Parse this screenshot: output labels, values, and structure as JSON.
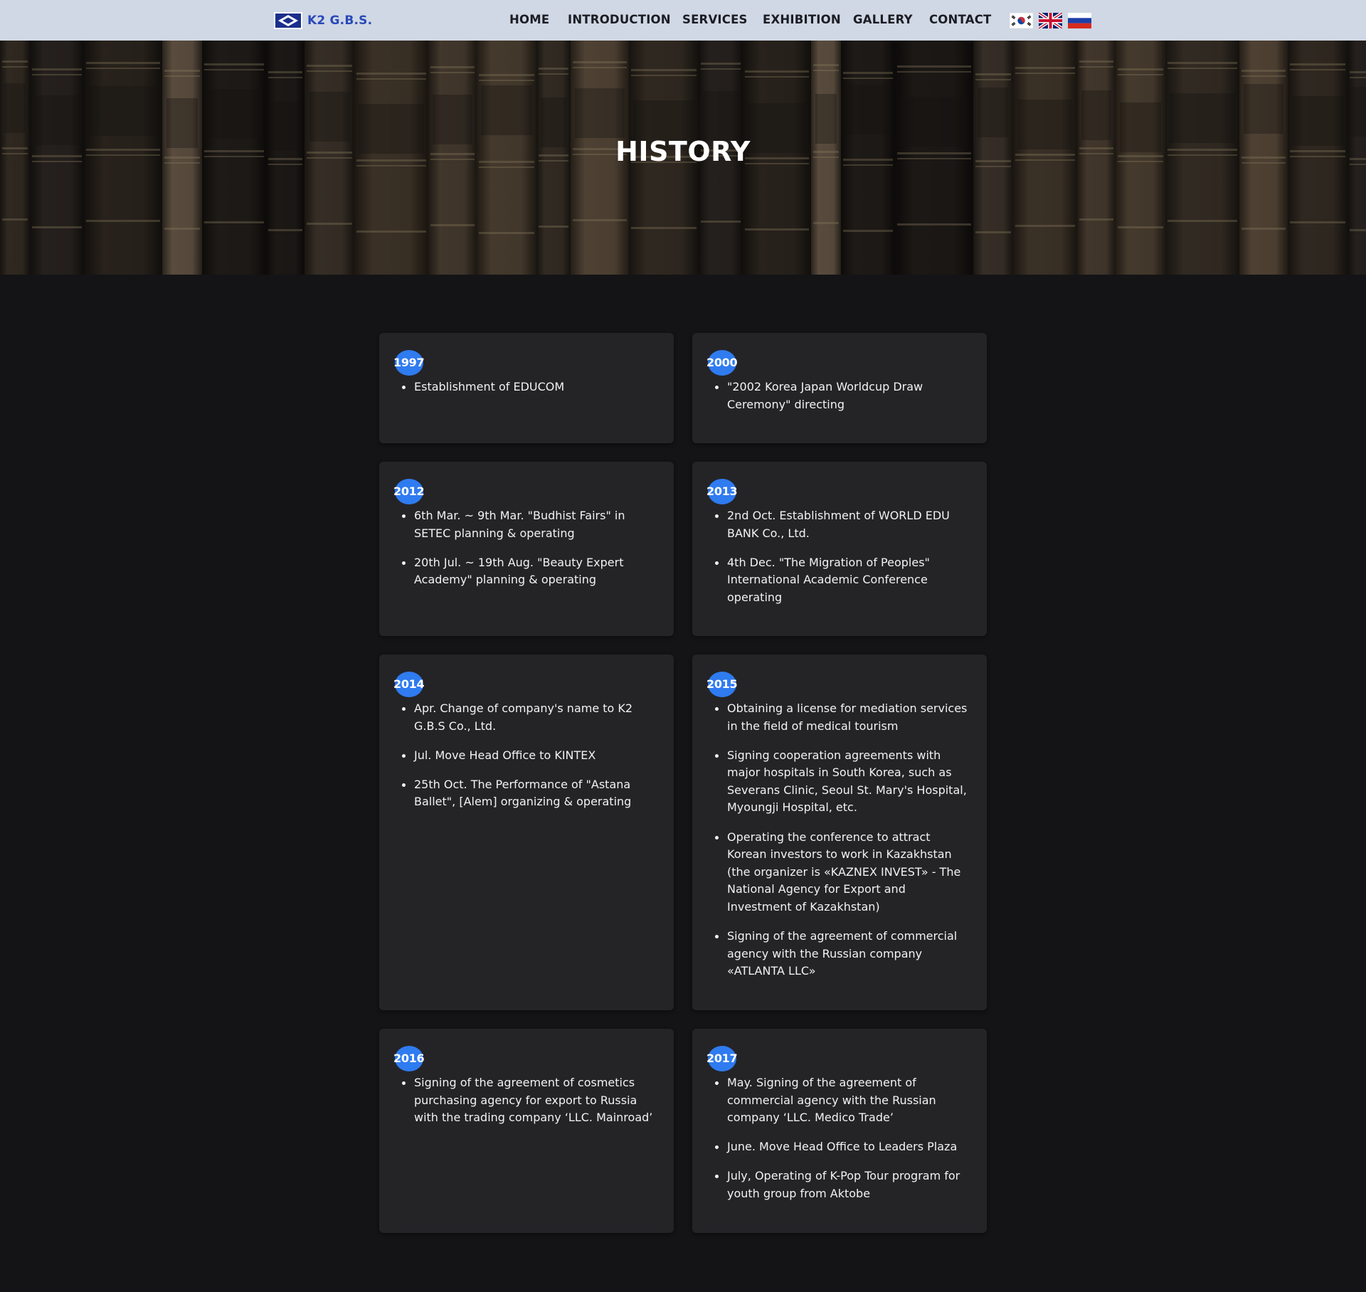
{
  "nav": {
    "brand": "K2 G.B.S.",
    "links": [
      "HOME",
      "INTRODUCTION",
      "SERVICES",
      "EXHIBITION",
      "GALLERY",
      "CONTACT"
    ]
  },
  "hero": {
    "title": "HISTORY"
  },
  "history": [
    {
      "year": "1997",
      "items": [
        "Establishment of EDUCOM"
      ]
    },
    {
      "year": "2000",
      "items": [
        "\"2002 Korea Japan Worldcup Draw Ceremony\" directing"
      ]
    },
    {
      "year": "2012",
      "items": [
        "6th Mar. ~ 9th Mar. \"Budhist Fairs\" in SETEC planning & operating",
        "20th Jul. ~ 19th Aug. \"Beauty Expert Academy\" planning & operating"
      ]
    },
    {
      "year": "2013",
      "items": [
        "2nd Oct. Establishment of WORLD EDU BANK Co., Ltd.",
        "4th Dec. \"The Migration of Peoples\" International Academic Conference operating"
      ]
    },
    {
      "year": "2014",
      "items": [
        "Apr. Change of company's name to K2 G.B.S Co., Ltd.",
        "Jul. Move Head Office to KINTEX",
        "25th Oct. The Performance of \"Astana Ballet\", [Alem] organizing & operating"
      ]
    },
    {
      "year": "2015",
      "items": [
        "Obtaining a license for mediation services in the field of medical tourism",
        "Signing cooperation agreements with major hospitals in South Korea, such as Severans Clinic, Seoul St. Mary's Hospital, Myoungji Hospital, etc.",
        "Operating the conference to attract Korean investors to work in Kazakhstan (the organizer is «KAZNEX INVEST» - The National Agency for Export and Investment of Kazakhstan)",
        "Signing of the agreement of commercial agency with the Russian company «ATLANTA LLC»"
      ]
    },
    {
      "year": "2016",
      "items": [
        "Signing of the agreement of cosmetics purchasing agency for export to Russia with the trading company ‘LLC. Mainroad’"
      ]
    },
    {
      "year": "2017",
      "items": [
        "May. Signing of the agreement of commercial agency with the Russian company ‘LLC. Medico Trade’",
        "June. Move Head Office to Leaders Plaza",
        "July, Operating of K-Pop Tour program for youth group from Aktobe"
      ]
    }
  ]
}
